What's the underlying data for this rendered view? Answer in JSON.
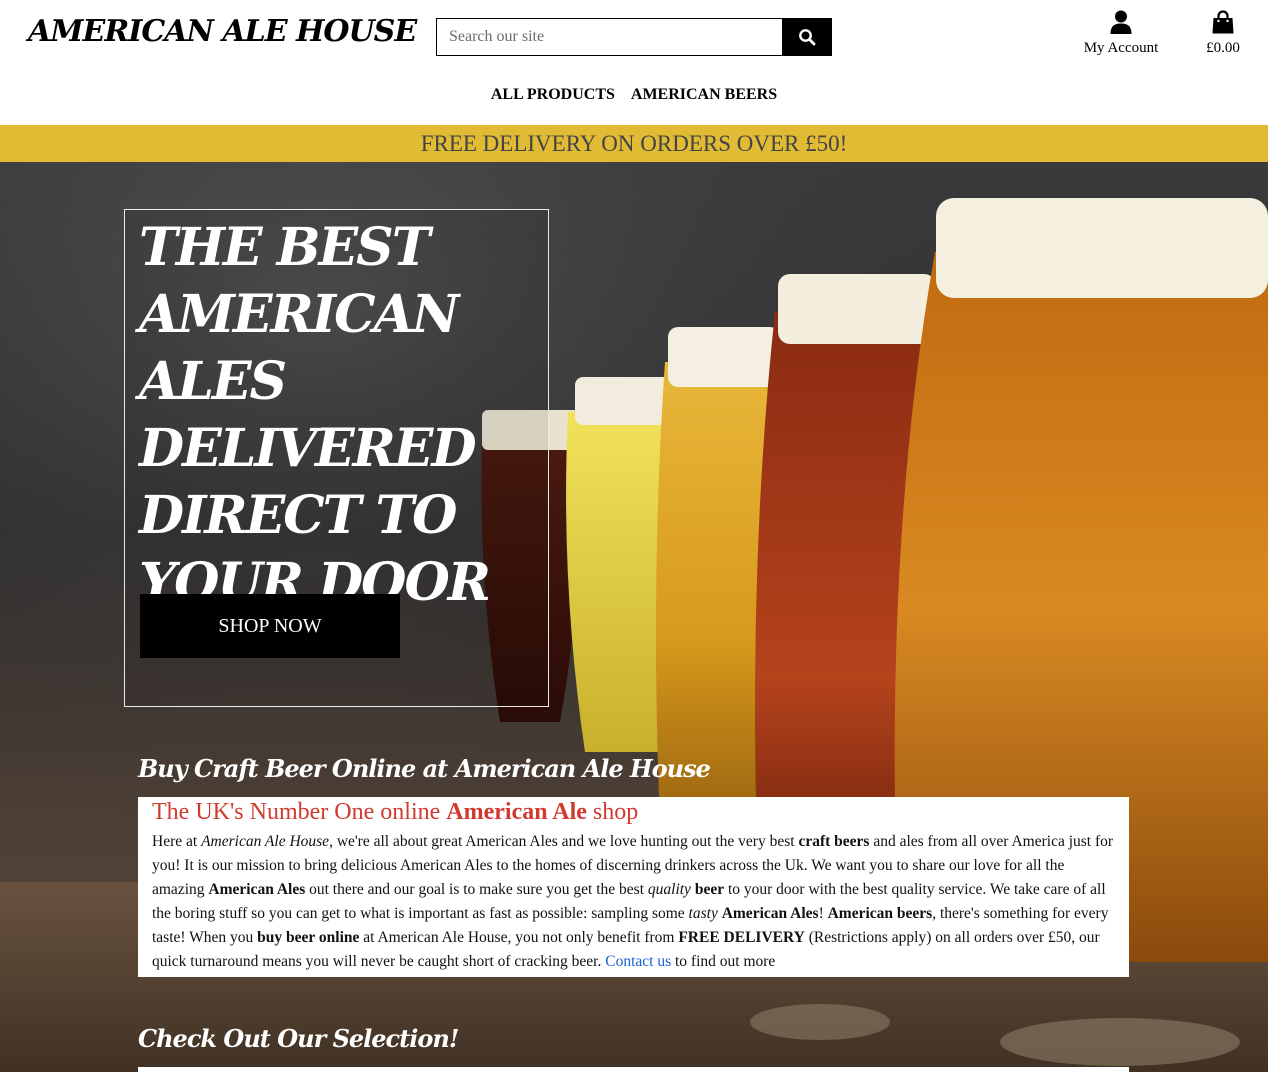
{
  "header": {
    "logo": "AMERICAN ALE HOUSE",
    "search": {
      "placeholder": "Search our site"
    },
    "account_label": "My Account",
    "cart_total": "£0.00"
  },
  "nav": {
    "items": [
      {
        "label": "ALL PRODUCTS"
      },
      {
        "label": "AMERICAN BEERS"
      }
    ]
  },
  "banner": {
    "text": "FREE DELIVERY ON ORDERS OVER £50!",
    "color": "#e2bb35"
  },
  "hero": {
    "title": "THE BEST AMERICAN ALES DELIVERED DIRECT TO YOUR DOOR",
    "cta_label": "SHOP NOW"
  },
  "intro": {
    "section_title": "Buy Craft Beer Online at American Ale House",
    "heading_pre": "The UK's Number One online ",
    "heading_bold": "American Ale",
    "heading_post": " shop",
    "p": {
      "t1": "Here at ",
      "i1": "American Ale House",
      "t2": ", we're all about great American Ales and we love hunting out the very best ",
      "b1": "craft beers",
      "t3": " and ales from all over America just for you! It is our mission to bring delicious American Ales to the homes of discerning drinkers across the Uk. We want you to share our love for all the amazing ",
      "b2": "American Ales",
      "t4": " out there and our goal is to make sure you get the best ",
      "i2": "quality",
      "t5": " ",
      "b3": "beer",
      "t6": " to your door with the best quality service. We take care of all the boring stuff so you can get to what is important as fast as possible: sampling some ",
      "i3": "tasty",
      "t7": " ",
      "b4": "American Ales",
      "t8": "! ",
      "b5": "American beers",
      "t9": ", there's something for every taste! When you ",
      "b6": "buy beer online",
      "t10": " at American Ale House, you not only benefit from ",
      "b7": "FREE DELIVERY",
      "t11": " (Restrictions apply) on all orders over £50, our quick turnaround means you will never be caught short of cracking beer. ",
      "link": "Contact us",
      "t12": " to find out more"
    },
    "accent_color": "#d03a2f"
  },
  "selection": {
    "title": "Check Out Our Selection!"
  }
}
